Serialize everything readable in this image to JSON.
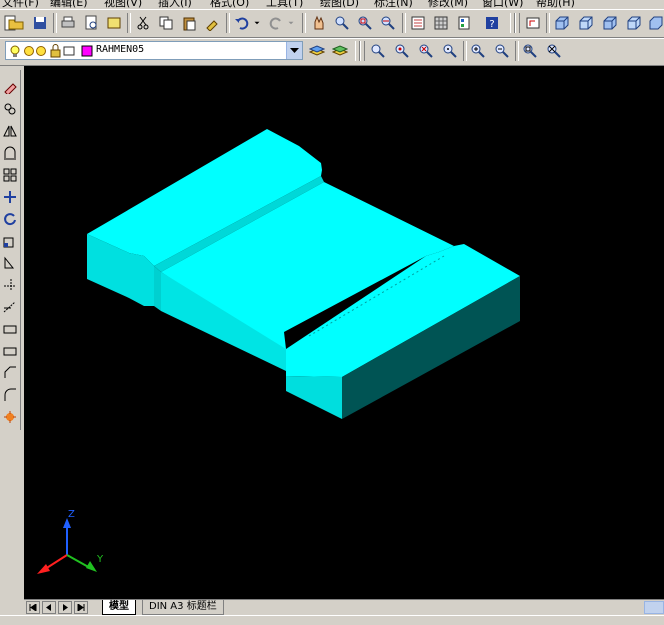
{
  "menu": {
    "items": [
      "文件(F)",
      "编辑(E)",
      "视图(V)",
      "插入(I)",
      "格式(O)",
      "工具(T)",
      "绘图(D)",
      "标注(N)",
      "修改(M)",
      "窗口(W)",
      "帮助(H)"
    ]
  },
  "layer_toolbar": {
    "current_layer": "RAHMEN05",
    "layer_color": "#ff00ff"
  },
  "viewport": {
    "background": "#000000",
    "model_color": "#00ffff",
    "model_side_color": "#00d4d4",
    "model_dark_color": "#005050",
    "ucs": {
      "z_label": "Z",
      "y_label": "Y",
      "x_color": "#ff2020",
      "y_color": "#20c020",
      "z_color": "#2060ff"
    }
  },
  "tabs": {
    "model": "模型",
    "layout": "DIN A3 标题栏"
  },
  "icons": {
    "toolbar1": [
      "new-icon",
      "open-icon",
      "save-icon",
      "print-icon",
      "preview-icon",
      "publish-icon",
      "cut-icon",
      "copy-icon",
      "paste-icon",
      "matchprop-icon",
      "undo-icon",
      "redo-icon",
      "pan-icon",
      "zoom-realtime-icon",
      "zoom-window-icon",
      "zoom-previous-icon",
      "properties-icon",
      "designcenter-icon",
      "toolpalette-icon",
      "help-icon",
      "ucs-icon",
      "view-top-icon",
      "view-bottom-icon",
      "view-left-icon",
      "view-right-icon",
      "view-front-icon"
    ],
    "toolbar2": [
      "bulb-icon",
      "sun-icon",
      "lock-icon",
      "layer-manager-icon",
      "layer-previous-icon",
      "zoom-window-icon",
      "zoom-dynamic-icon",
      "zoom-scale-icon",
      "zoom-center-icon",
      "zoom-in-icon",
      "zoom-out-icon",
      "zoom-all-icon",
      "zoom-extents-icon"
    ],
    "leftbar": [
      "erase-icon",
      "copy-icon",
      "mirror-icon",
      "offset-icon",
      "array-icon",
      "move-icon",
      "rotate-icon",
      "scale-icon",
      "stretch-icon",
      "trim-icon",
      "extend-icon",
      "break-icon",
      "join-icon",
      "chamfer-icon",
      "fillet-icon",
      "explode-icon"
    ]
  }
}
